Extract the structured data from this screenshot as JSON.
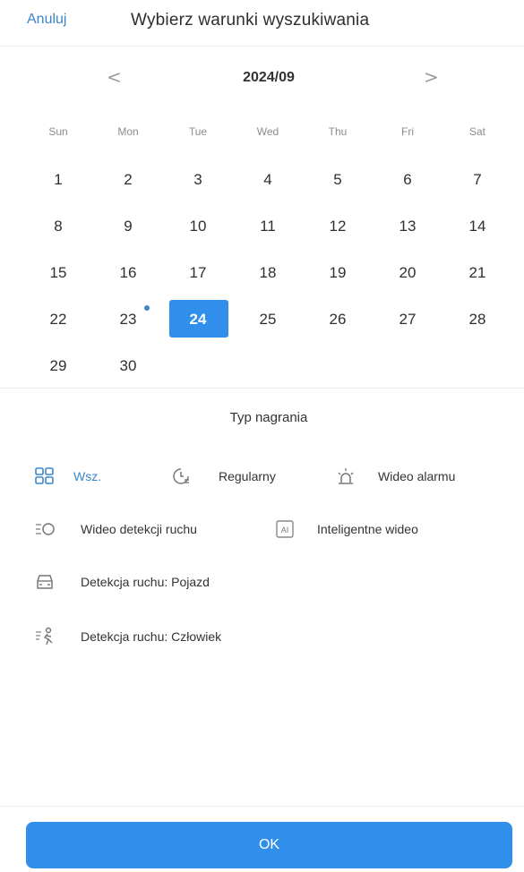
{
  "header": {
    "cancel_label": "Anuluj",
    "title": "Wybierz warunki wyszukiwania"
  },
  "calendar": {
    "prev_icon": "<",
    "next_icon": ">",
    "month_label": "2024/09",
    "weekdays": [
      "Sun",
      "Mon",
      "Tue",
      "Wed",
      "Thu",
      "Fri",
      "Sat"
    ],
    "days": [
      "1",
      "2",
      "3",
      "4",
      "5",
      "6",
      "7",
      "8",
      "9",
      "10",
      "11",
      "12",
      "13",
      "14",
      "15",
      "16",
      "17",
      "18",
      "19",
      "20",
      "21",
      "22",
      "23",
      "24",
      "25",
      "26",
      "27",
      "28",
      "29",
      "30"
    ],
    "selected_day": "24",
    "marked_day": "23",
    "accent_color": "#2f8fea"
  },
  "recording_type": {
    "title": "Typ nagrania",
    "options": [
      {
        "label": "Wsz.",
        "icon": "grid-icon",
        "active": true
      },
      {
        "label": "Regularny",
        "icon": "clock-icon",
        "active": false
      },
      {
        "label": "Wideo alarmu",
        "icon": "alarm-light-icon",
        "active": false
      },
      {
        "label": "Wideo detekcji ruchu",
        "icon": "motion-icon",
        "active": false
      },
      {
        "label": "Inteligentne wideo",
        "icon": "ai-icon",
        "active": false
      },
      {
        "label": "Detekcja ruchu: Pojazd",
        "icon": "vehicle-icon",
        "active": false
      },
      {
        "label": "Detekcja ruchu: Człowiek",
        "icon": "person-running-icon",
        "active": false
      }
    ]
  },
  "footer": {
    "ok_label": "OK"
  }
}
